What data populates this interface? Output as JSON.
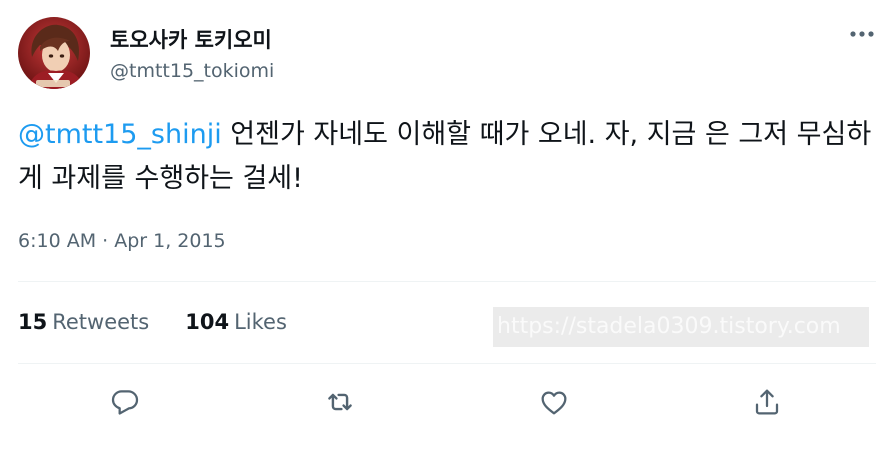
{
  "author": {
    "display_name": "토오사카 토키오미",
    "handle": "@tmtt15_tokiomi"
  },
  "tweet": {
    "mention": "@tmtt15_shinji",
    "text": " 언젠가 자네도 이해할 때가 오네. 자, 지금 은 그저 무심하게 과제를 수행하는 걸세!",
    "timestamp": "6:10 AM · Apr 1, 2015"
  },
  "stats": {
    "retweets_count": "15",
    "retweets_label": "Retweets",
    "likes_count": "104",
    "likes_label": "Likes"
  },
  "watermark": "https://stadela0309.tistory.com",
  "icons": {
    "more": "more-dots-icon",
    "reply": "reply-icon",
    "retweet": "retweet-icon",
    "like": "heart-icon",
    "share": "share-icon"
  },
  "colors": {
    "text": "#0f1419",
    "secondary": "#536471",
    "accent": "#1d9bf0",
    "divider": "#eff3f4"
  }
}
